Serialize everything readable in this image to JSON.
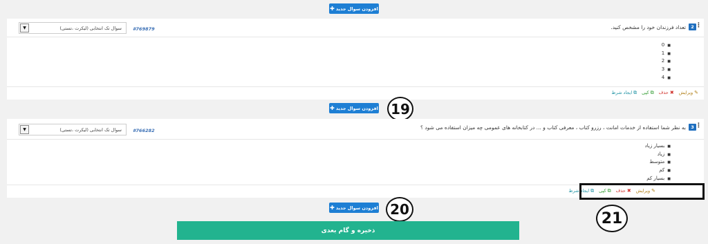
{
  "add_question_label": "افزودن سوال جدید",
  "questions": [
    {
      "number": "2",
      "text": "تعداد فرزندان خود را مشخص کنید.",
      "id": "#769879",
      "type": "سوال تک انتخابی (لیکرت ،تستی)",
      "options": [
        "0",
        "1",
        "2",
        "3",
        "4"
      ]
    },
    {
      "number": "3",
      "text": "به نظر شما استفاده از خدمات امانت ، رزرو کتاب ، معرفی کتاب و ... در کتابخانه های عمومی چه میزان استفاده می شود ؟",
      "id": "#766282",
      "type": "سوال تک انتخابی (لیکرت ،تستی)",
      "options": [
        "بسیار زیاد",
        "زیاد",
        "متوسط",
        "کم",
        "بسیار کم"
      ]
    }
  ],
  "actions": {
    "edit": "ویرایش",
    "delete": "حذف",
    "copy": "کپی",
    "condition": "ایجاد شرط"
  },
  "callouts": [
    "19",
    "20",
    "21"
  ],
  "save_next_label": "ذخیره و گام بعدی"
}
